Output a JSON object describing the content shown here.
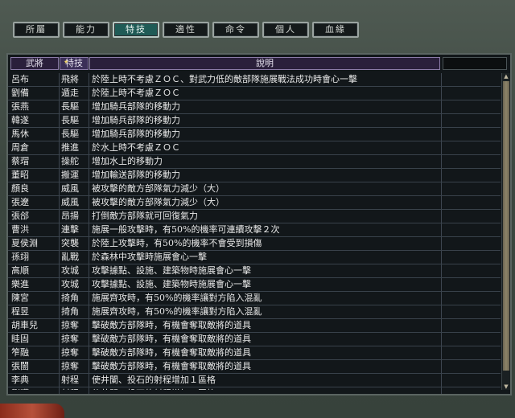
{
  "tabs": [
    {
      "label": "所屬",
      "active": false
    },
    {
      "label": "能力",
      "active": false
    },
    {
      "label": "特技",
      "active": true
    },
    {
      "label": "適性",
      "active": false
    },
    {
      "label": "命令",
      "active": false
    },
    {
      "label": "個人",
      "active": false
    },
    {
      "label": "血緣",
      "active": false
    }
  ],
  "table": {
    "headers": {
      "name": "武將",
      "skill": "特技",
      "desc": "說明"
    },
    "rows": [
      {
        "name": "呂布",
        "skill": "飛將",
        "desc": "於陸上時不考慮ＺＯＣ、對武力低的敵部隊施展戰法成功時會心一擊"
      },
      {
        "name": "劉備",
        "skill": "遁走",
        "desc": "於陸上時不考慮ＺＯＣ"
      },
      {
        "name": "張燕",
        "skill": "長驅",
        "desc": "增加騎兵部隊的移動力"
      },
      {
        "name": "韓遂",
        "skill": "長驅",
        "desc": "增加騎兵部隊的移動力"
      },
      {
        "name": "馬休",
        "skill": "長驅",
        "desc": "增加騎兵部隊的移動力"
      },
      {
        "name": "周倉",
        "skill": "推進",
        "desc": "於水上時不考慮ＺＯＣ"
      },
      {
        "name": "蔡瑁",
        "skill": "操舵",
        "desc": "增加水上的移動力"
      },
      {
        "name": "董昭",
        "skill": "搬運",
        "desc": "增加輸送部隊的移動力"
      },
      {
        "name": "顏良",
        "skill": "威風",
        "desc": "被攻擊的敵方部隊氣力減少（大）"
      },
      {
        "name": "張遼",
        "skill": "威風",
        "desc": "被攻擊的敵方部隊氣力減少（大）"
      },
      {
        "name": "張郃",
        "skill": "昂揚",
        "desc": "打倒敵方部隊就可回復氣力"
      },
      {
        "name": "曹洪",
        "skill": "連擊",
        "desc": "施展一般攻擊時，有50%的機率可連續攻擊２次"
      },
      {
        "name": "夏侯淵",
        "skill": "突襲",
        "desc": "於陸上攻擊時，有50%的機率不會受到損傷"
      },
      {
        "name": "孫翊",
        "skill": "亂戰",
        "desc": "於森林中攻擊時施展會心一擊"
      },
      {
        "name": "高順",
        "skill": "攻城",
        "desc": "攻擊據點、設施、建築物時施展會心一擊"
      },
      {
        "name": "樂進",
        "skill": "攻城",
        "desc": "攻擊據點、設施、建築物時施展會心一擊"
      },
      {
        "name": "陳宮",
        "skill": "掎角",
        "desc": "施展齊攻時，有50%的機率讓對方陷入混亂"
      },
      {
        "name": "程昱",
        "skill": "掎角",
        "desc": "施展齊攻時，有50%的機率讓對方陷入混亂"
      },
      {
        "name": "胡車兒",
        "skill": "掠奪",
        "desc": "擊破敵方部隊時，有機會奪取敵將的道具"
      },
      {
        "name": "眭固",
        "skill": "掠奪",
        "desc": "擊破敵方部隊時，有機會奪取敵將的道具"
      },
      {
        "name": "笮融",
        "skill": "掠奪",
        "desc": "擊破敵方部隊時，有機會奪取敵將的道具"
      },
      {
        "name": "張闓",
        "skill": "掠奪",
        "desc": "擊破敵方部隊時，有機會奪取敵將的道具"
      },
      {
        "name": "李典",
        "skill": "射程",
        "desc": "使井闌、投石的射程增加１區格"
      },
      {
        "name": "劉曄",
        "skill": "射程",
        "desc": "使井闌、投石的射程增加１區格"
      }
    ]
  },
  "icons": {
    "sort": "sort-star-icon",
    "scroll_up": "scroll-up-icon",
    "scroll_down": "scroll-down-icon"
  },
  "colors": {
    "active_tab": "#1f5b56",
    "header_bg": "#2a1f3b",
    "panel_bg": "#12171a"
  }
}
